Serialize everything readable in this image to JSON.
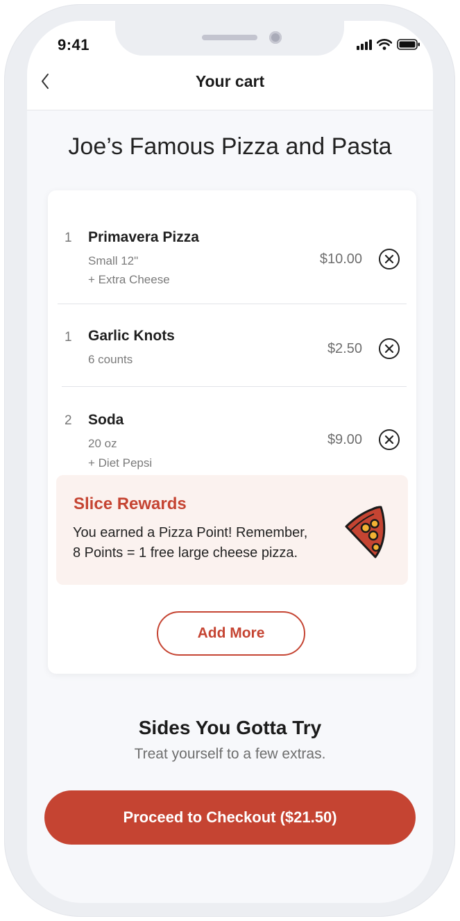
{
  "status_bar": {
    "time": "9:41"
  },
  "nav": {
    "title": "Your cart"
  },
  "restaurant": {
    "name": "Joe’s Famous Pizza and Pasta"
  },
  "cart": {
    "items": [
      {
        "qty": "1",
        "name": "Primavera Pizza",
        "details": [
          "Small 12\"",
          "+ Extra Cheese"
        ],
        "price": "$10.00"
      },
      {
        "qty": "1",
        "name": "Garlic Knots",
        "details": [
          "6 counts"
        ],
        "price": "$2.50"
      },
      {
        "qty": "2",
        "name": "Soda",
        "details": [
          "20 oz",
          "+ Diet Pepsi"
        ],
        "price": "$9.00"
      }
    ]
  },
  "rewards": {
    "title": "Slice Rewards",
    "line1": "You earned a Pizza Point! Remember,",
    "line2": "8 Points = 1 free large cheese pizza."
  },
  "actions": {
    "add_more": "Add More",
    "checkout": "Proceed to Checkout ($21.50)"
  },
  "sides": {
    "title": "Sides You Gotta Try",
    "subtitle": "Treat yourself to a few extras."
  },
  "icons": {
    "back": "chevron-left-icon",
    "remove": "close-circle-icon",
    "rewards": "pizza-slice-icon"
  },
  "colors": {
    "accent": "#c54432",
    "rewards_bg": "#fbf2ef",
    "screen_bg": "#f7f8fb"
  }
}
